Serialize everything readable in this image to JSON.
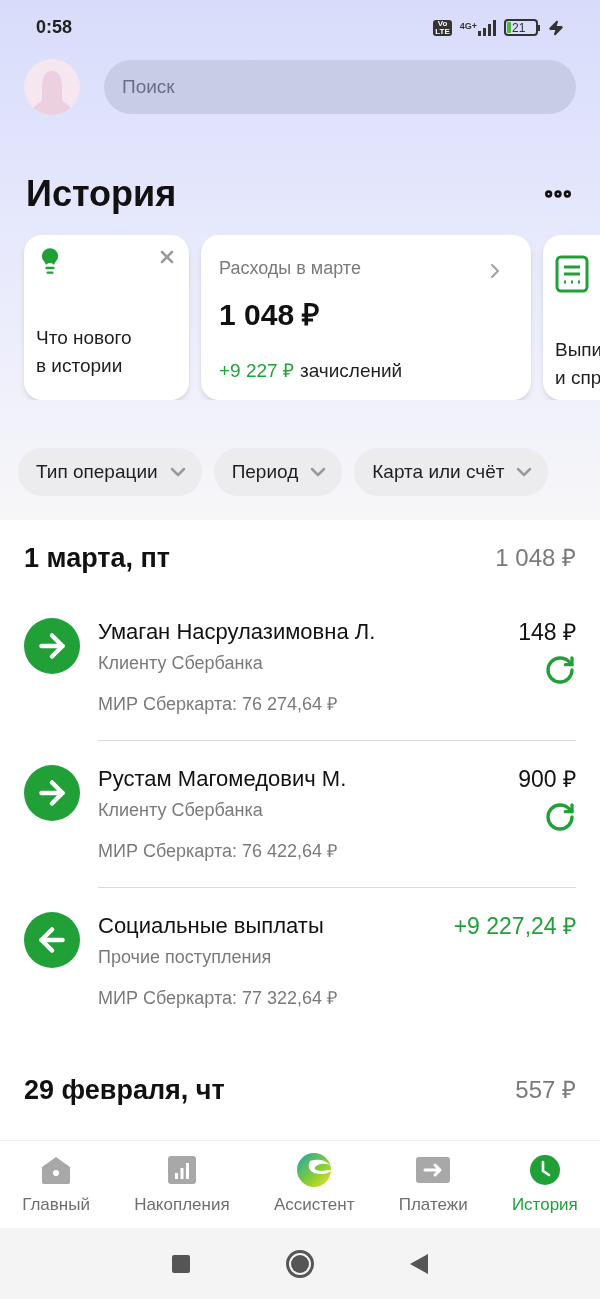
{
  "status_bar": {
    "time": "0:58",
    "volte_top": "Vo",
    "volte_bottom": "LTE",
    "network": "4G+",
    "battery": "21",
    "charging": true
  },
  "search": {
    "placeholder": "Поиск"
  },
  "title": "История",
  "cards": [
    {
      "kind": "tip",
      "lines": [
        "Что нового",
        "в истории"
      ]
    },
    {
      "kind": "summary",
      "label": "Расходы в марте",
      "amount": "1 048 ₽",
      "income": "+9 227 ₽",
      "income_label": "зачислений"
    },
    {
      "kind": "statement",
      "lines": [
        "Выпи",
        "и спр"
      ]
    }
  ],
  "filters": [
    "Тип операции",
    "Период",
    "Карта или счёт"
  ],
  "days": [
    {
      "date": "1 марта, пт",
      "total": "1 048 ₽",
      "operations": [
        {
          "kind": "outgoing",
          "name": "Умаган Насрулазимовна Л.",
          "category": "Клиенту Сбербанка",
          "account": "МИР Сберкарта: 76 274,64 ₽",
          "amount": "148 ₽",
          "repeat": true
        },
        {
          "kind": "outgoing",
          "name": "Рустам Магомедович М.",
          "category": "Клиенту Сбербанка",
          "account": "МИР Сберкарта: 76 422,64 ₽",
          "amount": "900 ₽",
          "repeat": true
        },
        {
          "kind": "incoming",
          "name": "Социальные выплаты",
          "category": "Прочие поступления",
          "account": "МИР Сберкарта: 77 322,64 ₽",
          "amount": "+9 227,24 ₽",
          "repeat": false
        }
      ]
    },
    {
      "date": "29 февраля, чт",
      "total": "557 ₽"
    }
  ],
  "nav": [
    {
      "kind": "home",
      "label": "Главный",
      "selected": false
    },
    {
      "kind": "savings",
      "label": "Накопления",
      "selected": false
    },
    {
      "kind": "assistant",
      "label": "Ассистент",
      "selected": false
    },
    {
      "kind": "payments",
      "label": "Платежи",
      "selected": false
    },
    {
      "kind": "history",
      "label": "История",
      "selected": true
    }
  ]
}
